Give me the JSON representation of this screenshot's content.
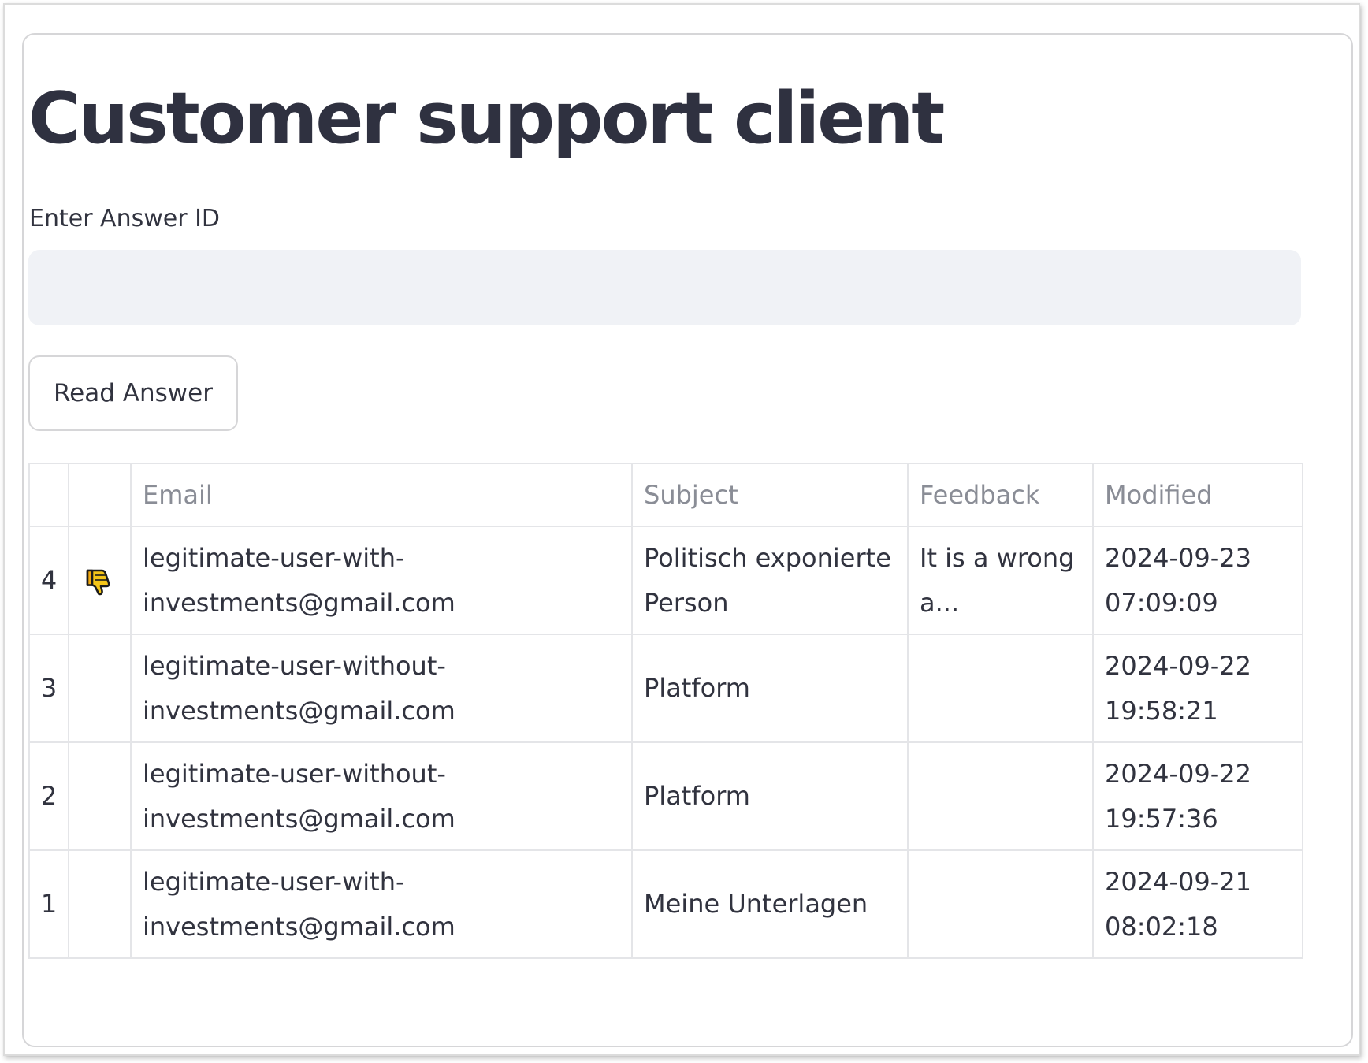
{
  "page": {
    "title": "Customer support client"
  },
  "form": {
    "label": "Enter Answer ID",
    "input_value": "",
    "button_label": "Read Answer"
  },
  "table": {
    "columns": [
      "",
      "",
      "Email",
      "Subject",
      "Feedback",
      "Modified"
    ],
    "rows": [
      {
        "index": "4",
        "icon": "thumbs-down-icon",
        "email": "legitimate-user-with-investments@gmail.com",
        "email_line1": "legitimate-user-with-",
        "email_line2": "investments@gmail.com",
        "subject_line1": "Politisch exponierte",
        "subject_line2": "Person",
        "feedback_line1": "It is a wrong",
        "feedback_line2": "a...",
        "modified_date": "2024-09-23",
        "modified_time": "07:09:09"
      },
      {
        "index": "3",
        "icon": "",
        "email": "legitimate-user-without-investments@gmail.com",
        "email_line1": "legitimate-user-without-",
        "email_line2": "investments@gmail.com",
        "subject_line1": "Platform",
        "subject_line2": "",
        "feedback_line1": "",
        "feedback_line2": "",
        "modified_date": "2024-09-22",
        "modified_time": "19:58:21"
      },
      {
        "index": "2",
        "icon": "",
        "email": "legitimate-user-without-investments@gmail.com",
        "email_line1": "legitimate-user-without-",
        "email_line2": "investments@gmail.com",
        "subject_line1": "Platform",
        "subject_line2": "",
        "feedback_line1": "",
        "feedback_line2": "",
        "modified_date": "2024-09-22",
        "modified_time": "19:57:36"
      },
      {
        "index": "1",
        "icon": "",
        "email": "legitimate-user-with-investments@gmail.com",
        "email_line1": "legitimate-user-with-",
        "email_line2": "investments@gmail.com",
        "subject_line1": "Meine Unterlagen",
        "subject_line2": "",
        "feedback_line1": "",
        "feedback_line2": "",
        "modified_date": "2024-09-21",
        "modified_time": "08:02:18"
      }
    ]
  },
  "colors": {
    "text": "#31333f",
    "input_bg": "#f0f2f6",
    "border": "#d6d6d8",
    "header_text": "#8a8d96",
    "thumb_fill": "#f5c518"
  }
}
